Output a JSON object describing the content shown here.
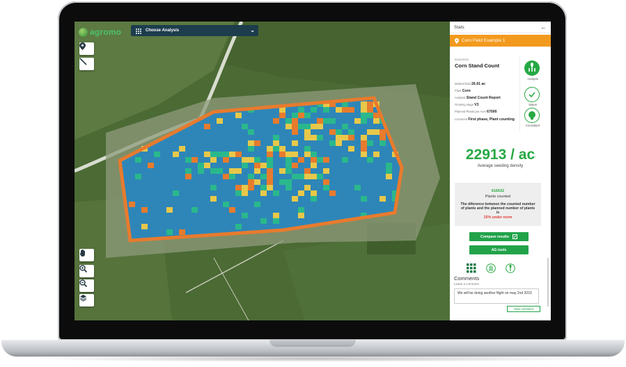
{
  "app": {
    "logo_text": "agromo"
  },
  "toolbar": {
    "analysis_label": "Choose Analysis"
  },
  "map_tools": [
    {
      "name": "location-pin-tool",
      "icon": "pin-icon"
    },
    {
      "name": "measure-line-tool",
      "icon": "line-icon"
    },
    {
      "name": "hand-tool",
      "icon": "hand-icon"
    },
    {
      "name": "zoom-in-tool",
      "icon": "zoom-in-icon"
    },
    {
      "name": "zoom-out-tool",
      "icon": "zoom-out-icon"
    },
    {
      "name": "layers-tool",
      "icon": "layers-icon"
    }
  ],
  "panel": {
    "header": "Stats",
    "field_name": "Corn Field Example 1",
    "date": "02/01/2022",
    "title": "Corn Stand Count",
    "details": [
      {
        "label": "Marked field",
        "value": "26.91 ac"
      },
      {
        "label": "Plant",
        "value": "Corn"
      },
      {
        "label": "Analysis",
        "value": "Stand Count Report"
      },
      {
        "label": "Growing stage",
        "value": "V3"
      },
      {
        "label": "Planned Plants per Acre",
        "value": "67000"
      },
      {
        "label": "Comment",
        "value": "First phase, Plant counting"
      }
    ],
    "status_icons": [
      {
        "label": "Analysis",
        "icon": "plant-icon",
        "color": "#27a844"
      },
      {
        "label": "Status",
        "icon": "check-icon",
        "color": "#27a844"
      },
      {
        "label": "Consultant",
        "icon": "brain-icon",
        "color": "#27a844"
      }
    ],
    "density_value": "22913 / ac",
    "density_label": "Average seeding density",
    "plants_count": "616632",
    "plants_label": "Plants counted",
    "difference_text": "The diference between the counted number of plants and the planned number of plants is",
    "difference_result": "15% under norm",
    "compare_button": "Compare results",
    "ag_tools_button": "AG tools",
    "tabs": [
      {
        "icon": "grid-icon"
      },
      {
        "icon": "wheat-icon"
      },
      {
        "icon": "sprout-icon"
      }
    ],
    "comments_title": "Comments",
    "comments_subtitle": "Leave a comment",
    "comment_text": "We will be doing another flight on may 2nd 2023",
    "save_button": "Save comment"
  },
  "colors": {
    "accent_green": "#27a844",
    "field_orange": "#f39a1e",
    "toolbar_blue": "#1d3d4d",
    "heat_blue": "#2e86b8",
    "heat_teal": "#2ab88c",
    "heat_yellow": "#e8c84a",
    "heat_orange": "#e77b2e"
  }
}
